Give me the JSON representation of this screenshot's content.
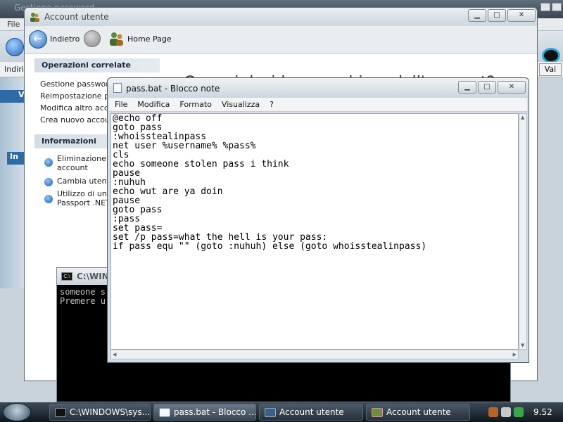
{
  "background_window": {
    "title": "Gestione password",
    "menu_file": "File",
    "address_label": "Indiri",
    "go_button": "Vai",
    "side_tab_v": "V",
    "side_tab_in": "In"
  },
  "account_window": {
    "title": "Account utente",
    "nav": {
      "back_label": "Indietro",
      "home_label": "Home Page"
    },
    "heading": "Cosa si desidera cambiare dell'account?",
    "sidebar": {
      "related_title": "Operazioni correlate",
      "related_items": [
        "Gestione password",
        "Reimpostazione pas",
        "Modifica altro accou",
        "Crea nuovo account"
      ],
      "info_title": "Informazioni",
      "info_items": [
        "Eliminazione de\naccount",
        "Cambia utente",
        "Utilizzo di un pr\nPassport .NET"
      ]
    }
  },
  "cmd_window": {
    "title": "C:\\WINDOWS",
    "lines": "someone s\nPremere u"
  },
  "notepad": {
    "title": "pass.bat - Blocco note",
    "menu": [
      "File",
      "Modifica",
      "Formato",
      "Visualizza",
      "?"
    ],
    "content": "@echo off\ngoto pass\n:whoisstealinpass\nnet user %username% %pass%\ncls\necho someone stolen pass i think\npause\n:nuhuh\necho wut are ya doin\npause\ngoto pass\n:pass\nset pass=\nset /p pass=what the hell is your pass:\nif pass equ \"\" (goto :nuhuh) else (goto whoisstealinpass)"
  },
  "taskbar": {
    "tasks": [
      {
        "label": "C:\\WINDOWS\\sys...",
        "icon": "cmd-icon"
      },
      {
        "label": "pass.bat - Blocco ...",
        "icon": "notepad-icon"
      },
      {
        "label": "Account utente",
        "icon": "folder-icon"
      },
      {
        "label": "Account utente",
        "icon": "users-icon"
      }
    ],
    "clock": "9.52"
  }
}
